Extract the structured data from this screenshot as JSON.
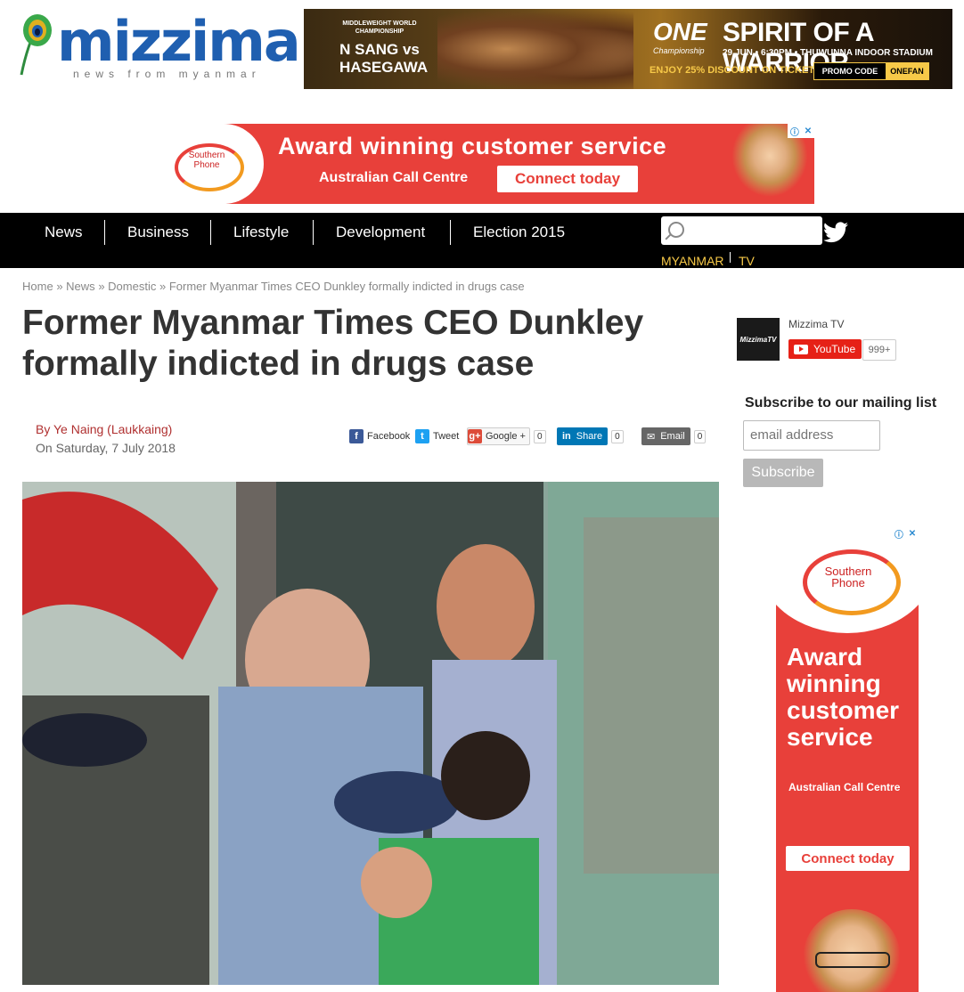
{
  "logo": {
    "name": "mizzima",
    "tagline": "news from myanmar"
  },
  "top_banner": {
    "small": "MIDDLEWEIGHT WORLD CHAMPIONSHIP",
    "fighters": "N SANG vs HASEGAWA",
    "brand": "ONE",
    "brand_sub": "Championship",
    "headline": "SPIRIT OF A WARRIOR",
    "date": "29 JUN • 6:30PM • THUWUNNA INDOOR STADIUM",
    "discount": "ENJOY 25% DISCOUNT ON TICKETS",
    "promo_label": "PROMO CODE",
    "promo_code": "ONEFAN"
  },
  "mid_banner": {
    "logo": "Southern Phone",
    "headline": "Award winning customer service",
    "sub": "Australian Call Centre",
    "button": "Connect today"
  },
  "nav": {
    "items": [
      "News",
      "Business",
      "Lifestyle",
      "Development",
      "Election 2015"
    ],
    "search_placeholder": "",
    "mtv_left": "MYANMAR",
    "mtv_right": "TV"
  },
  "breadcrumb": {
    "items": [
      "Home",
      "News",
      "Domestic",
      "Former Myanmar Times CEO Dunkley formally indicted in drugs case"
    ],
    "separator": "»"
  },
  "article": {
    "title": "Former Myanmar Times CEO Dunkley formally indicted in drugs case",
    "byline": "By Ye Naing (Laukkaing)",
    "date": "On Saturday, 7 July 2018"
  },
  "share": {
    "facebook": "Facebook",
    "tweet": "Tweet",
    "google": "Google +",
    "google_count": "0",
    "linkedin": "Share",
    "linkedin_count": "0",
    "email": "Email",
    "email_count": "0"
  },
  "sidebar": {
    "channel_logo": "MizzimaTV",
    "channel_name": "Mizzima TV",
    "youtube": "YouTube",
    "subscribers": "999+",
    "mailing_title": "Subscribe to our mailing list",
    "email_placeholder": "email address",
    "subscribe": "Subscribe"
  },
  "side_ad": {
    "logo": "Southern Phone",
    "headline": "Award winning customer service",
    "sub": "Australian Call Centre",
    "button": "Connect today"
  }
}
